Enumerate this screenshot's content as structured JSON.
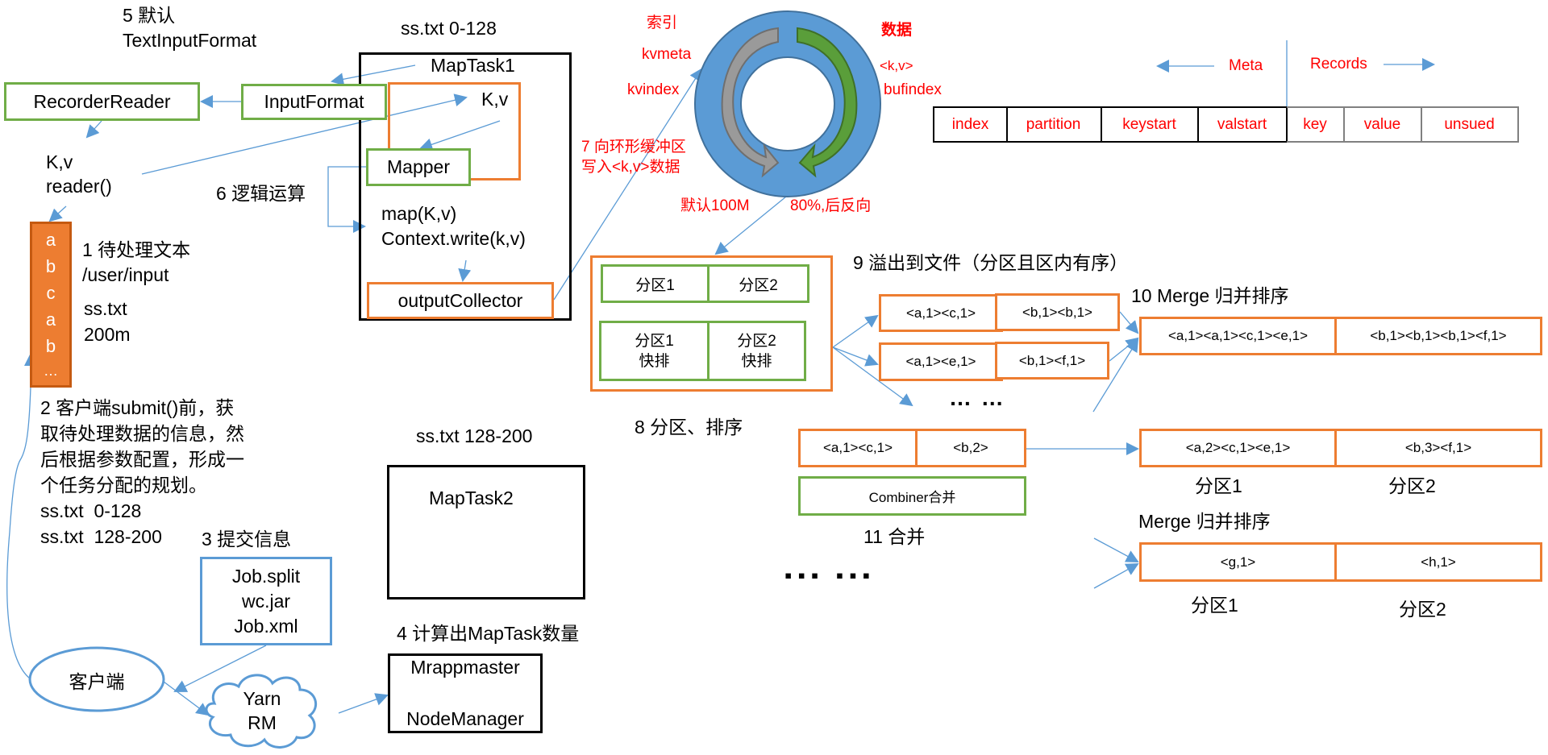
{
  "labels": {
    "step5_line1": "5 默认",
    "step5_line2": "TextInputFormat",
    "split1_label": "ss.txt 0-128",
    "split2_label": "ss.txt 128-200",
    "kv_reader_line1": "K,v",
    "kv_reader_line2": "reader()",
    "step6": "6 逻辑运算",
    "step1_line1": "1 待处理文本",
    "step1_line2": "/user/input",
    "file_name": "ss.txt",
    "file_size": "200m",
    "step2_lines": [
      "2 客户端submit()前，获",
      "取待处理数据的信息，然",
      "后根据参数配置，形成一",
      "个任务分配的规划。",
      "ss.txt  0-128",
      "ss.txt  128-200"
    ],
    "step3": "3 提交信息",
    "step4": "4 计算出MapTask数量",
    "index_label": "索引",
    "kvmeta": "kvmeta",
    "kvindex": "kvindex",
    "data_label": "数据",
    "kv_label": "<k,v>",
    "bufindex": "bufindex",
    "step7_line1": "7 向环形缓冲区",
    "step7_line2": "写入<k,v>数据",
    "default_100m": "默认100M",
    "reverse_80": "80%,后反向",
    "meta": "Meta",
    "records": "Records",
    "step9": "9 溢出到文件（分区且区内有序）",
    "step10": "10 Merge 归并排序",
    "step8": "8 分区、排序",
    "step11": "11 合并",
    "merge2": "Merge 归并排序",
    "ellipsis_spill": "… …",
    "ellipsis_bottom": "▪ ▪ ▪   ▪ ▪ ▪"
  },
  "boxes": {
    "recorder_reader": "RecorderReader",
    "input_format": "InputFormat",
    "maptask1": "MapTask1",
    "kv": "K,v",
    "mapper": "Mapper",
    "map_line1": "map(K,v)",
    "map_line2": "Context.write(k,v)",
    "output_collector": "outputCollector",
    "maptask2": "MapTask2",
    "mrappmaster": "Mrappmaster",
    "nodemanager": "NodeManager",
    "job_files": [
      "Job.split",
      "wc.jar",
      "Job.xml"
    ],
    "client": "客户端",
    "yarn_line1": "Yarn",
    "yarn_line2": "RM",
    "combiner": "Combiner合并"
  },
  "text_column": [
    "a",
    "b",
    "c",
    "a",
    "b",
    "…"
  ],
  "meta_table": {
    "meta_cells": [
      "index",
      "partition",
      "keystart",
      "valstart"
    ],
    "record_cells": [
      "key",
      "value",
      "unsued"
    ]
  },
  "partition_box": {
    "row1": [
      "分区1",
      "分区2"
    ],
    "row2": [
      "分区1\n快排",
      "分区2\n快排"
    ]
  },
  "spill_files": [
    [
      "<a,1><c,1>",
      "<b,1><b,1>"
    ],
    [
      "<a,1><e,1>",
      "<b,1><f,1>"
    ]
  ],
  "merged": [
    "<a,1><a,1><c,1><e,1>",
    "<b,1><b,1><b,1><f,1>"
  ],
  "combined_input": [
    "<a,1><c,1>",
    "<b,2>"
  ],
  "combined_output": [
    "<a,2><c,1><e,1>",
    "<b,3><f,1>"
  ],
  "combined_partitions": [
    "分区1",
    "分区2"
  ],
  "other_merge": [
    "<g,1>",
    "<h,1>"
  ],
  "other_partitions": [
    "分区1",
    "分区2"
  ],
  "colors": {
    "green": "#70ad47",
    "orange": "#ed7d31",
    "blue": "#5b9bd5",
    "red": "#ff0000",
    "gray_arrow": "#8c8c8c",
    "green_arrow": "#548235"
  }
}
